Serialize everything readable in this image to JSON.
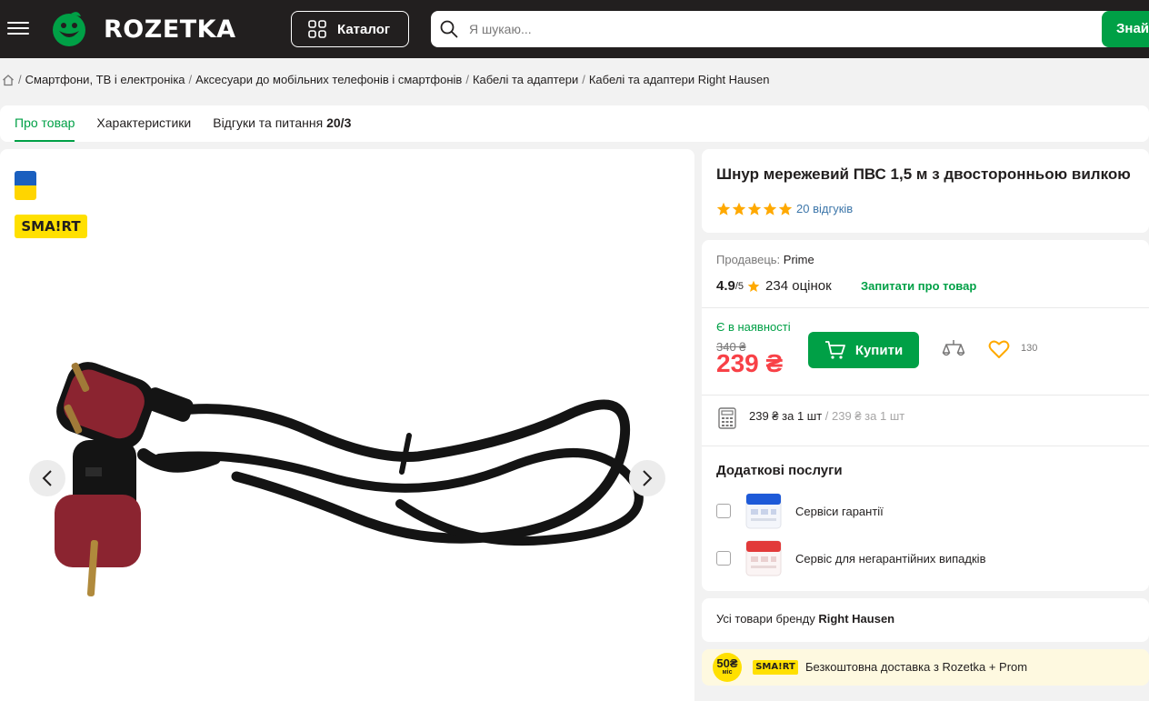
{
  "header": {
    "logo_text": "ROZETKA",
    "catalog_label": "Каталог",
    "search_placeholder": "Я шукаю...",
    "search_button": "Знай"
  },
  "breadcrumbs": [
    "Смартфони, ТВ і електроніка",
    "Аксесуари до мобільних телефонів і смартфонів",
    "Кабелі та адаптери",
    "Кабелі та адаптери Right Hausen"
  ],
  "tabs": {
    "about": "Про товар",
    "specs": "Характеристики",
    "reviews_label": "Відгуки та питання",
    "reviews_count": "20/3"
  },
  "gallery": {
    "badge": "SMA!RT"
  },
  "product": {
    "title": "Шнур мережевий ПВС 1,5 м з двосторонньою вилкою",
    "rating_stars": 5,
    "reviews_link": "20 відгуків"
  },
  "seller": {
    "label": "Продавець:",
    "name": "Prime",
    "rating": "4.9",
    "rating_max": "/5",
    "ratings_count": "234 оцінок",
    "ask_link": "Запитати про товар"
  },
  "price": {
    "stock": "Є в наявності",
    "old": "340 ₴",
    "current": "239 ₴",
    "buy_label": "Купити",
    "favorites_count": "130",
    "per_unit": "239 ₴ за 1 шт",
    "per_unit_alt": "239 ₴ за 1 шт"
  },
  "services": {
    "title": "Додаткові послуги",
    "items": [
      {
        "label": "Сервіси гарантії",
        "color": "#1e5ad8"
      },
      {
        "label": "Сервіс для негарантійних випадків",
        "color": "#e23a3a"
      }
    ]
  },
  "brand": {
    "prefix": "Усі товари бренду",
    "name": "Right Hausen"
  },
  "delivery": {
    "coin_value": "50₴",
    "coin_unit": "міс",
    "badge": "SMA!RT",
    "text": "Безкоштовна доставка з Rozetka + Prom"
  },
  "colors": {
    "brand_green": "#00a046",
    "price_red": "#f84147",
    "header_bg": "#221f1f",
    "star": "#ffa900",
    "link_blue": "#3e77aa"
  }
}
